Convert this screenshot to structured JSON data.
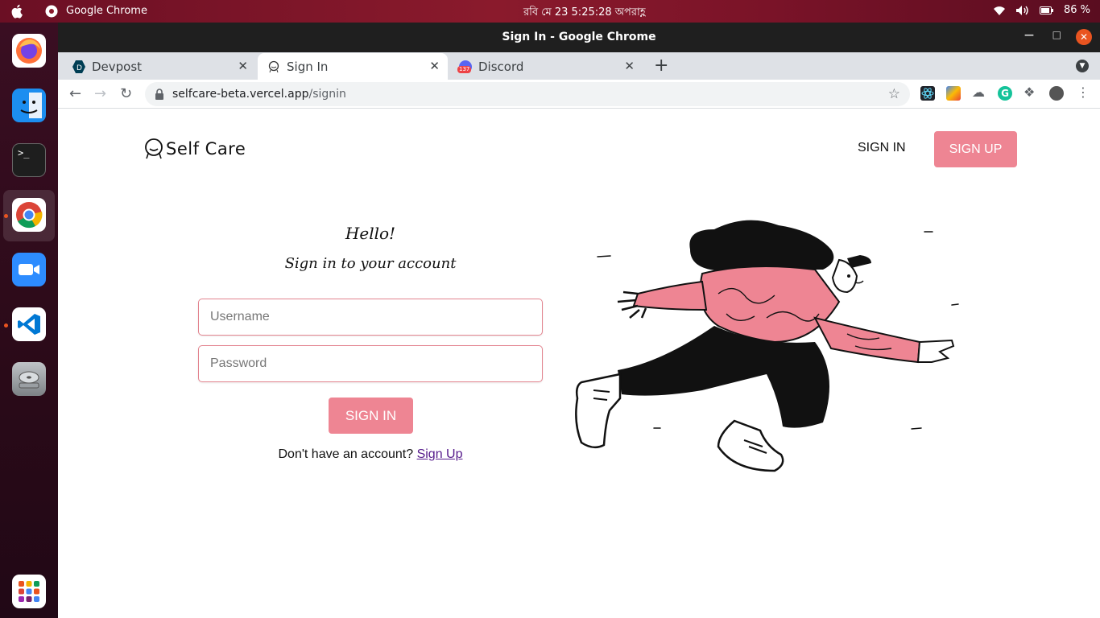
{
  "topbar": {
    "app_name": "Google Chrome",
    "clock": "রবি মে 23   5:25:28 অপরাহ্ণ",
    "battery": "86 %"
  },
  "window": {
    "title": "Sign In - Google Chrome"
  },
  "tabs": [
    {
      "label": "Devpost",
      "active": false
    },
    {
      "label": "Sign In",
      "active": true
    },
    {
      "label": "Discord",
      "active": false,
      "badge": "137"
    }
  ],
  "omnibox": {
    "domain": "selfcare-beta.vercel.app",
    "path": "/signin"
  },
  "site": {
    "logo_text": "Self Care",
    "nav_signin": "SIGN IN",
    "nav_signup": "SIGN UP"
  },
  "form": {
    "greeting": "Hello!",
    "subheading": "Sign in to your account",
    "username_placeholder": "Username",
    "password_placeholder": "Password",
    "submit_label": "SIGN IN",
    "prompt_text": "Don't have an account?",
    "prompt_link": "Sign Up"
  },
  "colors": {
    "accent": "#ee8593",
    "input_border": "#e3848f",
    "ubuntu_orange": "#e95420"
  }
}
